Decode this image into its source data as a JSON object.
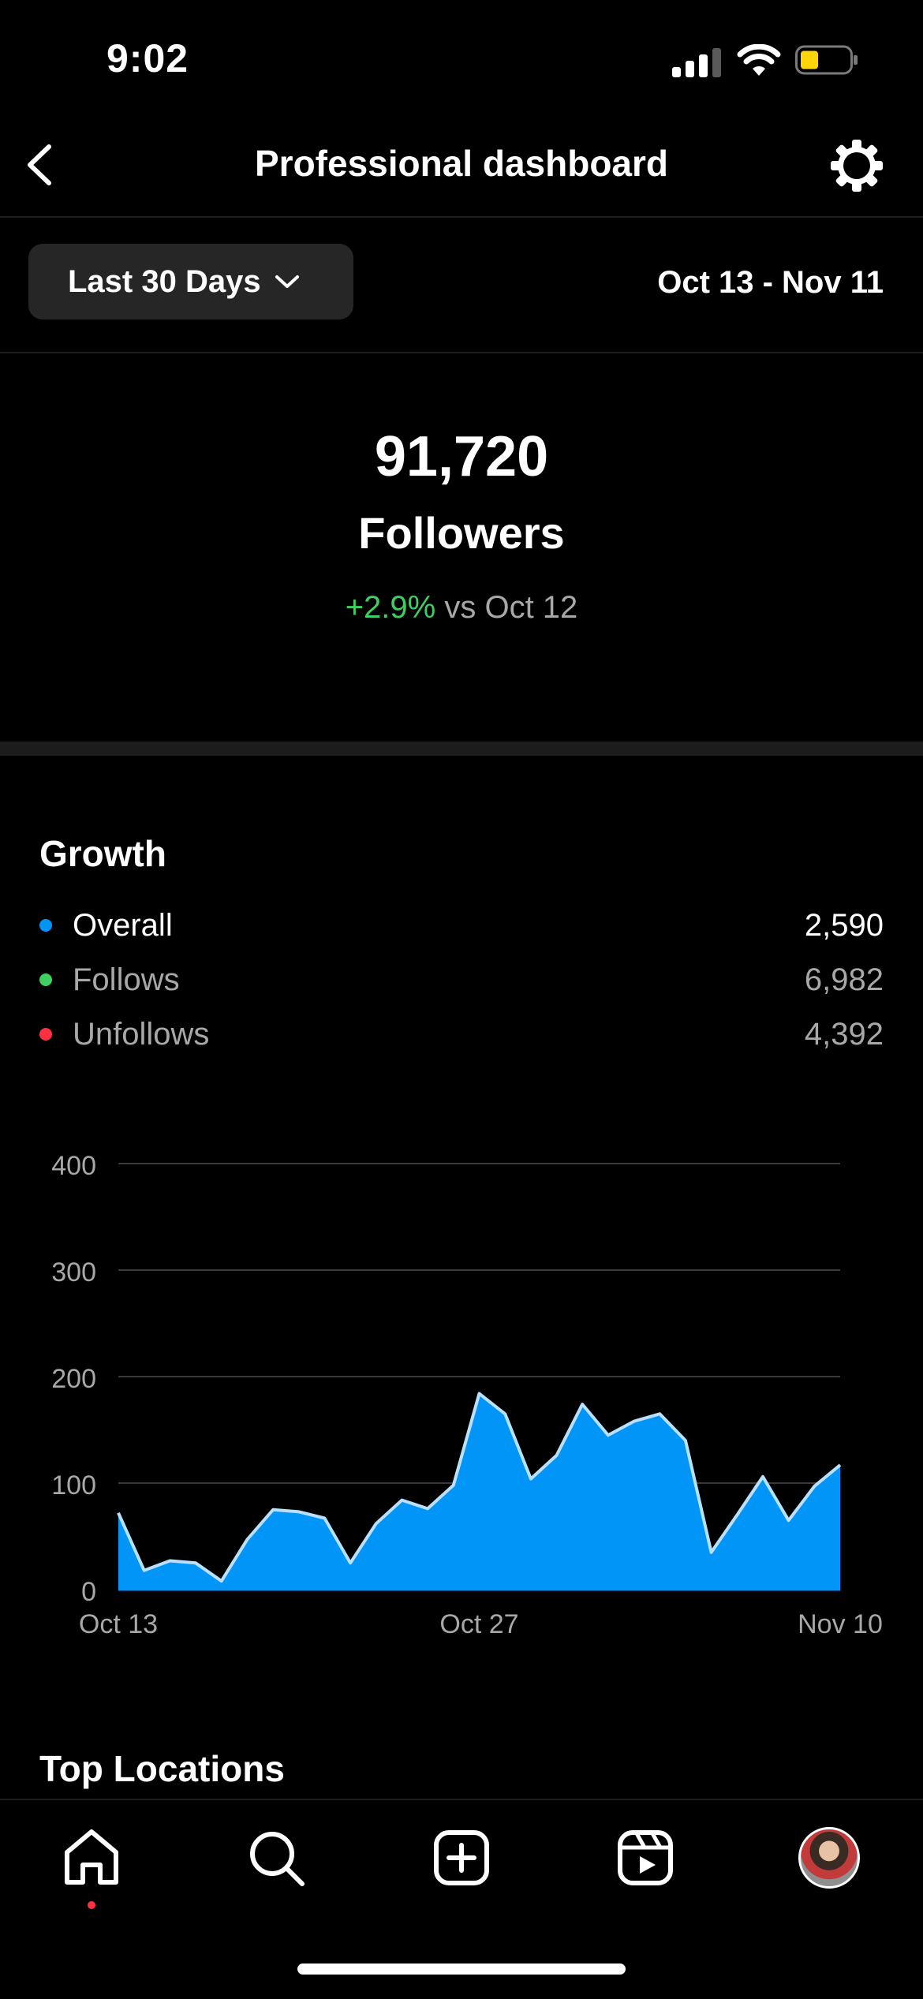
{
  "status_bar": {
    "time": "9:02"
  },
  "header": {
    "title": "Professional dashboard"
  },
  "filters": {
    "range_label": "Last 30 Days",
    "date_range": "Oct 13 - Nov 11"
  },
  "summary": {
    "followers_count": "91,720",
    "followers_label": "Followers",
    "change_pct": "+2.9%",
    "change_suffix": "vs Oct 12"
  },
  "growth": {
    "title": "Growth",
    "legend": [
      {
        "label": "Overall",
        "value": "2,590",
        "color": "#0095f6"
      },
      {
        "label": "Follows",
        "value": "6,982",
        "color": "#3cd15e"
      },
      {
        "label": "Unfollows",
        "value": "4,392",
        "color": "#ff3040"
      }
    ]
  },
  "chart_data": {
    "type": "area",
    "title": "",
    "xlabel": "",
    "ylabel": "",
    "x_tick_labels": [
      "Oct 13",
      "Oct 27",
      "Nov 10"
    ],
    "y_tick_labels": [
      "0",
      "100",
      "200",
      "300",
      "400"
    ],
    "ylim": [
      0,
      400
    ],
    "grid": true,
    "fill_color": "#0095f6",
    "line_color": "#b9e0ff",
    "x": [
      "Oct 13",
      "Oct 14",
      "Oct 15",
      "Oct 16",
      "Oct 17",
      "Oct 18",
      "Oct 19",
      "Oct 20",
      "Oct 21",
      "Oct 22",
      "Oct 23",
      "Oct 24",
      "Oct 25",
      "Oct 26",
      "Oct 27",
      "Oct 28",
      "Oct 29",
      "Oct 30",
      "Oct 31",
      "Nov 1",
      "Nov 2",
      "Nov 3",
      "Nov 4",
      "Nov 5",
      "Nov 6",
      "Nov 7",
      "Nov 8",
      "Nov 9",
      "Nov 10"
    ],
    "series": [
      {
        "values": [
          72,
          18,
          27,
          25,
          8,
          47,
          75,
          73,
          67,
          25,
          62,
          84,
          76,
          98,
          184,
          165,
          104,
          126,
          174,
          145,
          158,
          165,
          140,
          35,
          70,
          106,
          65,
          97,
          117
        ]
      }
    ]
  },
  "sections": {
    "top_locations_title": "Top Locations"
  },
  "tab_bar": {
    "items": [
      "home-icon",
      "search-icon",
      "create-icon",
      "reels-icon",
      "profile-avatar"
    ]
  }
}
